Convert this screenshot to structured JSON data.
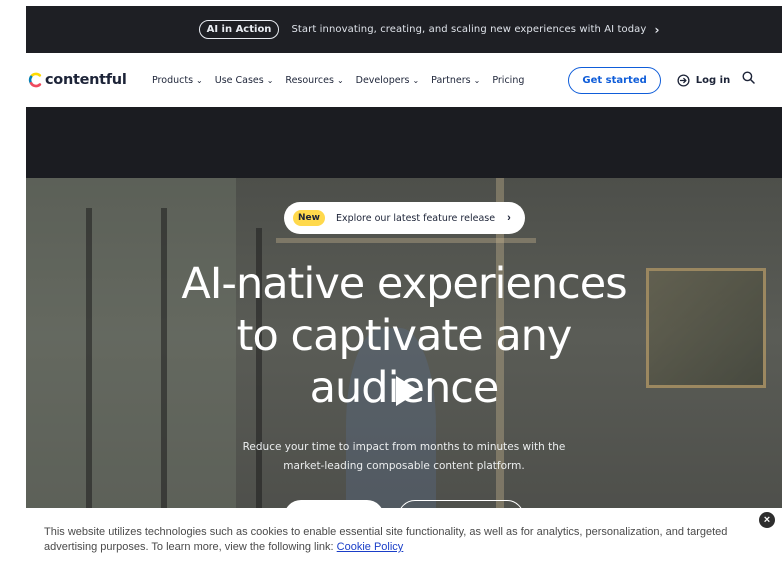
{
  "announcement": {
    "pill": "AI in Action",
    "message": "Start innovating, creating, and scaling new experiences with AI today",
    "chevron": "›"
  },
  "nav": {
    "logo_text": "contentful",
    "items": [
      {
        "label": "Products",
        "has_caret": true
      },
      {
        "label": "Use Cases",
        "has_caret": true
      },
      {
        "label": "Resources",
        "has_caret": true
      },
      {
        "label": "Developers",
        "has_caret": true
      },
      {
        "label": "Partners",
        "has_caret": true
      },
      {
        "label": "Pricing",
        "has_caret": false
      }
    ],
    "caret": "⌄",
    "get_started": "Get started",
    "login": "Log in",
    "icons": [
      "login-icon",
      "search-icon"
    ]
  },
  "hero": {
    "badge_new": "New",
    "badge_text": "Explore our latest feature release",
    "badge_arrow": "›",
    "headline_line1": "AI-native experiences",
    "headline_line2": "to captivate any",
    "headline_line3": "audience",
    "subtitle_line1": "Reduce your time to impact from months to minutes with the",
    "subtitle_line2": "market-leading composable content platform."
  },
  "cookie": {
    "text": "This website utilizes technologies such as cookies to enable essential site functionality, as well as for analytics, personalization, and targeted advertising purposes. To learn more, view the following link: ",
    "link": "Cookie Policy",
    "close": "×"
  },
  "colors": {
    "announce_bg": "#1e1f24",
    "accent_blue": "#0f5dd9",
    "badge_yellow": "#ffd94c",
    "logo_yellow": "#ffda00",
    "logo_blue": "#0681b6",
    "logo_red": "#ef4a5e"
  }
}
